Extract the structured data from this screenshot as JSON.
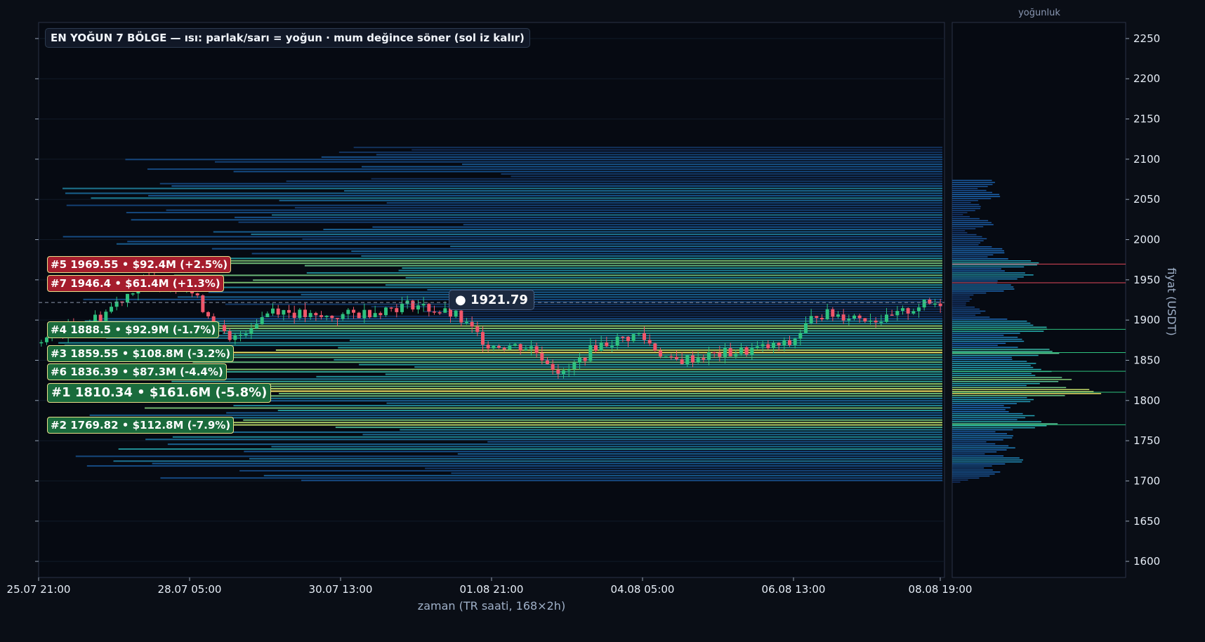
{
  "title": "EN YOĞUN 7 BÖLGE — ısı: parlak/sarı = yoğun · mum değince söner (sol iz kalır)",
  "current_price": "● 1921.79",
  "zones": [
    {
      "label": "#5  1969.55  •  $92.4M  (+2.5%)",
      "price": 1969.55,
      "dir": "up",
      "big": false
    },
    {
      "label": "#7  1946.4  •  $61.4M  (+1.3%)",
      "price": 1946.4,
      "dir": "up",
      "big": false
    },
    {
      "label": "#4  1888.5  •  $92.9M  (-1.7%)",
      "price": 1888.5,
      "dir": "dn",
      "big": false
    },
    {
      "label": "#3  1859.55  •  $108.8M  (-3.2%)",
      "price": 1859.55,
      "dir": "dn",
      "big": false
    },
    {
      "label": "#6  1836.39  •  $87.3M  (-4.4%)",
      "price": 1836.39,
      "dir": "dn",
      "big": false
    },
    {
      "label": "#1  1810.34  •  $161.6M  (-5.8%)",
      "price": 1810.34,
      "dir": "dn",
      "big": true
    },
    {
      "label": "#2  1769.82  •  $112.8M  (-7.9%)",
      "price": 1769.82,
      "dir": "dn",
      "big": false
    }
  ],
  "chart_data": {
    "type": "candlestick-heatmap",
    "xlabel": "zaman (TR saati, 168×2h)",
    "ylabel": "fiyat (USDT)",
    "profile_title": "yoğunluk",
    "ylim": [
      1580,
      2270
    ],
    "x_ticks": [
      "25.07 21:00",
      "28.07 05:00",
      "30.07 13:00",
      "01.08 21:00",
      "04.08 05:00",
      "06.08 13:00",
      "08.08 19:00"
    ],
    "y_ticks": [
      1600,
      1650,
      1700,
      1750,
      1800,
      1850,
      1900,
      1950,
      2000,
      2050,
      2100,
      2150,
      2200,
      2250
    ],
    "last_price": 1921.79,
    "close_path": [
      {
        "t": 0,
        "p": 1872
      },
      {
        "t": 12,
        "p": 1905
      },
      {
        "t": 20,
        "p": 1950
      },
      {
        "t": 28,
        "p": 1942
      },
      {
        "t": 36,
        "p": 1872
      },
      {
        "t": 44,
        "p": 1915
      },
      {
        "t": 52,
        "p": 1902
      },
      {
        "t": 60,
        "p": 1908
      },
      {
        "t": 70,
        "p": 1920
      },
      {
        "t": 78,
        "p": 1905
      },
      {
        "t": 84,
        "p": 1870
      },
      {
        "t": 92,
        "p": 1866
      },
      {
        "t": 98,
        "p": 1832
      },
      {
        "t": 104,
        "p": 1868
      },
      {
        "t": 112,
        "p": 1882
      },
      {
        "t": 118,
        "p": 1848
      },
      {
        "t": 124,
        "p": 1855
      },
      {
        "t": 132,
        "p": 1862
      },
      {
        "t": 140,
        "p": 1870
      },
      {
        "t": 145,
        "p": 1908
      },
      {
        "t": 152,
        "p": 1905
      },
      {
        "t": 158,
        "p": 1900
      },
      {
        "t": 164,
        "p": 1918
      },
      {
        "t": 168,
        "p": 1921.79
      }
    ],
    "heat_levels": [
      {
        "price": 2100,
        "intensity": 0.35
      },
      {
        "price": 2090,
        "intensity": 0.45
      },
      {
        "price": 2060,
        "intensity": 0.55
      },
      {
        "price": 2050,
        "intensity": 0.5
      },
      {
        "price": 2030,
        "intensity": 0.45
      },
      {
        "price": 2010,
        "intensity": 0.55
      },
      {
        "price": 1990,
        "intensity": 0.5
      },
      {
        "price": 1969.55,
        "intensity": 0.85
      },
      {
        "price": 1955,
        "intensity": 0.7
      },
      {
        "price": 1946.4,
        "intensity": 0.8
      },
      {
        "price": 1930,
        "intensity": 0.55
      },
      {
        "price": 1888.5,
        "intensity": 0.95
      },
      {
        "price": 1870,
        "intensity": 0.75
      },
      {
        "price": 1859.55,
        "intensity": 1.0
      },
      {
        "price": 1848,
        "intensity": 0.8
      },
      {
        "price": 1836.39,
        "intensity": 0.9
      },
      {
        "price": 1820,
        "intensity": 0.85
      },
      {
        "price": 1810.34,
        "intensity": 1.0
      },
      {
        "price": 1790,
        "intensity": 0.7
      },
      {
        "price": 1769.82,
        "intensity": 1.0
      },
      {
        "price": 1755,
        "intensity": 0.6
      },
      {
        "price": 1740,
        "intensity": 0.55
      },
      {
        "price": 1725,
        "intensity": 0.5
      },
      {
        "price": 1705,
        "intensity": 0.45
      }
    ],
    "profile": [
      {
        "price": 2070,
        "v": 0.28
      },
      {
        "price": 2055,
        "v": 0.3
      },
      {
        "price": 2040,
        "v": 0.18
      },
      {
        "price": 2020,
        "v": 0.26
      },
      {
        "price": 2000,
        "v": 0.22
      },
      {
        "price": 1985,
        "v": 0.35
      },
      {
        "price": 1969.55,
        "v": 0.55
      },
      {
        "price": 1955,
        "v": 0.5
      },
      {
        "price": 1940,
        "v": 0.4
      },
      {
        "price": 1925,
        "v": 0.12
      },
      {
        "price": 1910,
        "v": 0.2
      },
      {
        "price": 1895,
        "v": 0.5
      },
      {
        "price": 1888.5,
        "v": 0.62
      },
      {
        "price": 1875,
        "v": 0.45
      },
      {
        "price": 1859.55,
        "v": 0.68
      },
      {
        "price": 1845,
        "v": 0.55
      },
      {
        "price": 1836.39,
        "v": 0.6
      },
      {
        "price": 1825,
        "v": 0.75
      },
      {
        "price": 1810.34,
        "v": 0.95
      },
      {
        "price": 1800,
        "v": 0.5
      },
      {
        "price": 1790,
        "v": 0.35
      },
      {
        "price": 1780,
        "v": 0.5
      },
      {
        "price": 1769.82,
        "v": 0.65
      },
      {
        "price": 1755,
        "v": 0.4
      },
      {
        "price": 1740,
        "v": 0.38
      },
      {
        "price": 1725,
        "v": 0.45
      },
      {
        "price": 1710,
        "v": 0.3
      }
    ]
  }
}
